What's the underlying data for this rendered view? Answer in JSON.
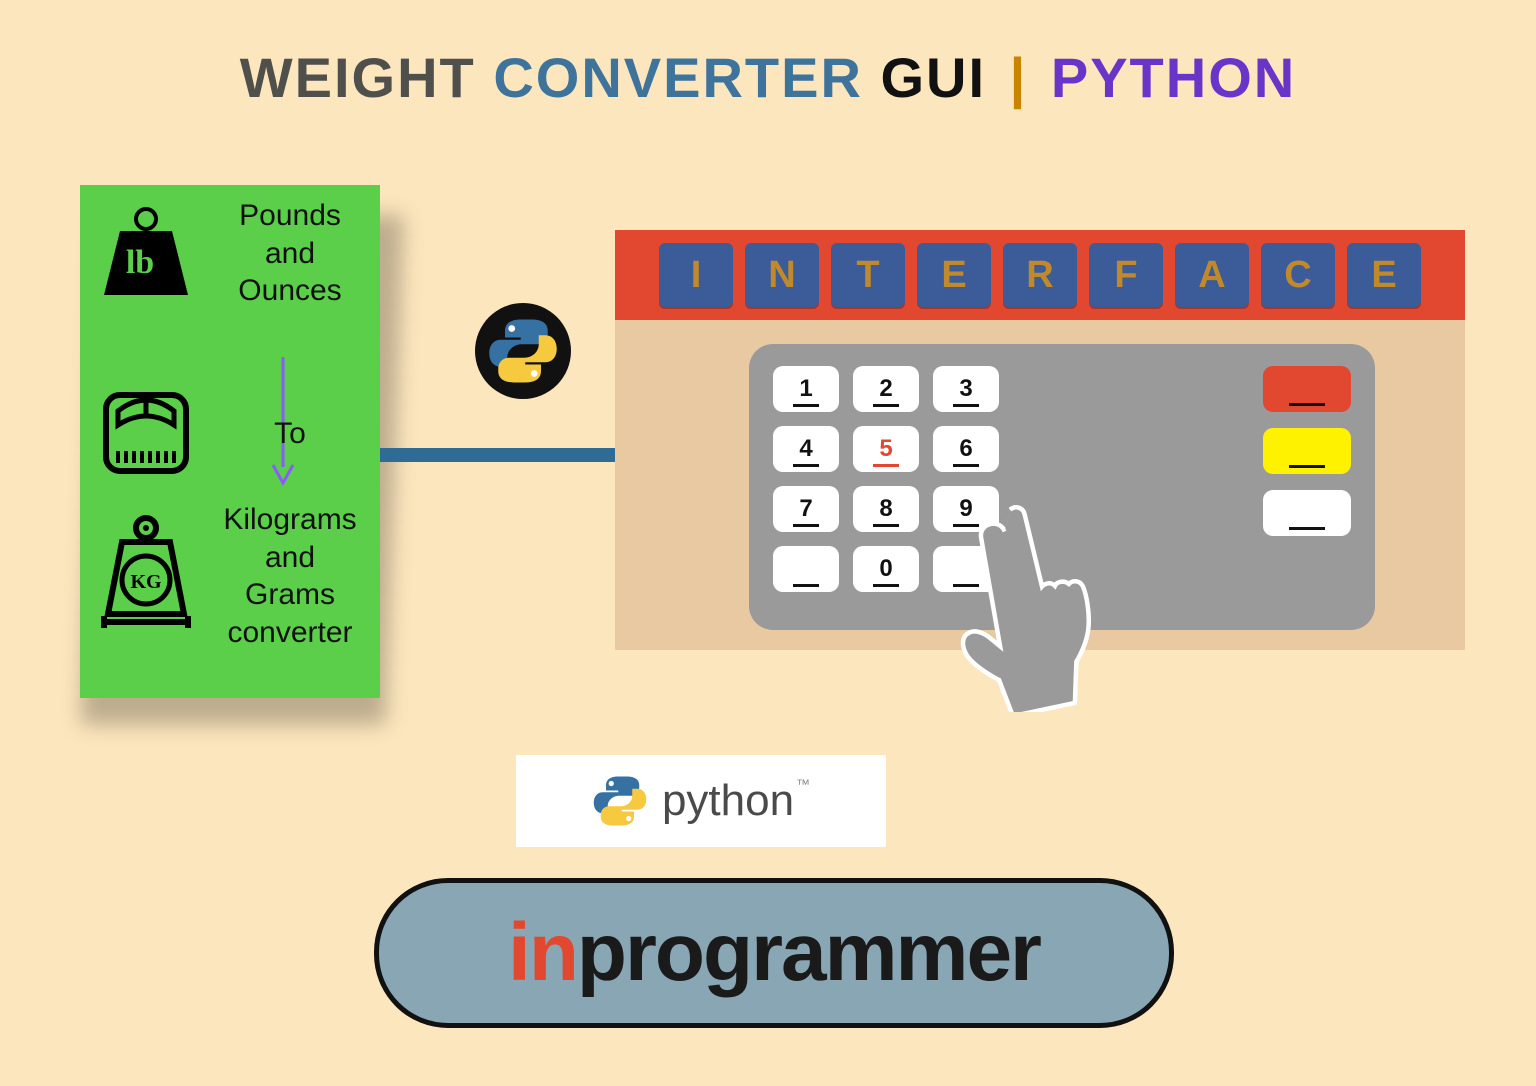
{
  "title": {
    "w1": "WEIGHT",
    "w2": "CONVERTER",
    "w3": "GUI",
    "bar": "|",
    "w4": "PYTHON"
  },
  "ticket": {
    "row1": "Pounds\nand\nOunces",
    "row2": "To",
    "row3": "Kilograms\nand\nGrams\nconverter"
  },
  "interface": {
    "letters": [
      "I",
      "N",
      "T",
      "E",
      "R",
      "F",
      "A",
      "C",
      "E"
    ],
    "keys": [
      "1",
      "2",
      "3",
      "4",
      "5",
      "6",
      "7",
      "8",
      "9",
      "",
      "0",
      ""
    ],
    "highlight_index": 4
  },
  "python_label": "python",
  "brand": {
    "prefix": "in",
    "rest": "programmer"
  },
  "icons": {
    "lb_text": "lb",
    "kg_text": "KG"
  }
}
